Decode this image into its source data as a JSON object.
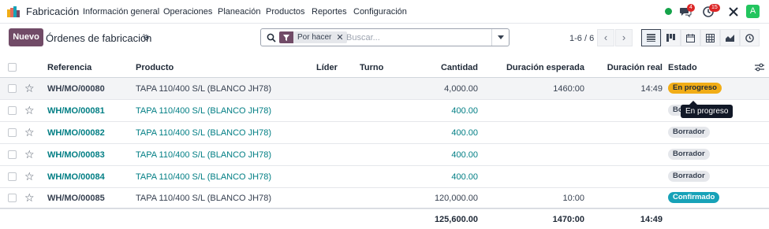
{
  "navbar": {
    "app_name": "Fabricación",
    "menu": [
      "Información general",
      "Operaciones",
      "Planeación",
      "Productos",
      "Reportes",
      "Configuración"
    ],
    "messages_count": "4",
    "activities_count": "15",
    "avatar_letter": "A",
    "online_color": "#15a34a"
  },
  "control": {
    "new_label": "Nuevo",
    "title": "Órdenes de fabricación",
    "filter_facet": "Por hacer",
    "search_placeholder": "Buscar...",
    "pager": "1-6 / 6"
  },
  "table": {
    "headers": {
      "reference": "Referencia",
      "product": "Producto",
      "leader": "Líder",
      "shift": "Turno",
      "quantity": "Cantidad",
      "expected_duration": "Duración esperada",
      "real_duration": "Duración real",
      "state": "Estado"
    },
    "rows": [
      {
        "reference": "WH/MO/00080",
        "product": "TAPA 110/400 S/L (BLANCO JH78)",
        "quantity": "4,000.00",
        "expected": "1460:00",
        "real": "14:49",
        "state": "En progreso",
        "state_kind": "progress",
        "linked": false
      },
      {
        "reference": "WH/MO/00081",
        "product": "TAPA 110/400 S/L (BLANCO JH78)",
        "quantity": "400.00",
        "expected": "",
        "real": "",
        "state": "Borrador",
        "state_kind": "draft",
        "linked": true
      },
      {
        "reference": "WH/MO/00082",
        "product": "TAPA 110/400 S/L (BLANCO JH78)",
        "quantity": "400.00",
        "expected": "",
        "real": "",
        "state": "Borrador",
        "state_kind": "draft",
        "linked": true
      },
      {
        "reference": "WH/MO/00083",
        "product": "TAPA 110/400 S/L (BLANCO JH78)",
        "quantity": "400.00",
        "expected": "",
        "real": "",
        "state": "Borrador",
        "state_kind": "draft",
        "linked": true
      },
      {
        "reference": "WH/MO/00084",
        "product": "TAPA 110/400 S/L (BLANCO JH78)",
        "quantity": "400.00",
        "expected": "",
        "real": "",
        "state": "Borrador",
        "state_kind": "draft",
        "linked": true
      },
      {
        "reference": "WH/MO/00085",
        "product": "TAPA 110/400 S/L (BLANCO JH78)",
        "quantity": "120,000.00",
        "expected": "10:00",
        "real": "",
        "state": "Confirmado",
        "state_kind": "confirmed",
        "linked": false
      }
    ],
    "totals": {
      "quantity": "125,600.00",
      "expected": "1470:00",
      "real": "14:49"
    }
  },
  "tooltip": "En progreso",
  "colors": {
    "brand": "#714b67",
    "link": "#017e84",
    "progress": "#f1ad17",
    "draft": "#e5e7eb",
    "confirmed": "#17a2b8"
  }
}
